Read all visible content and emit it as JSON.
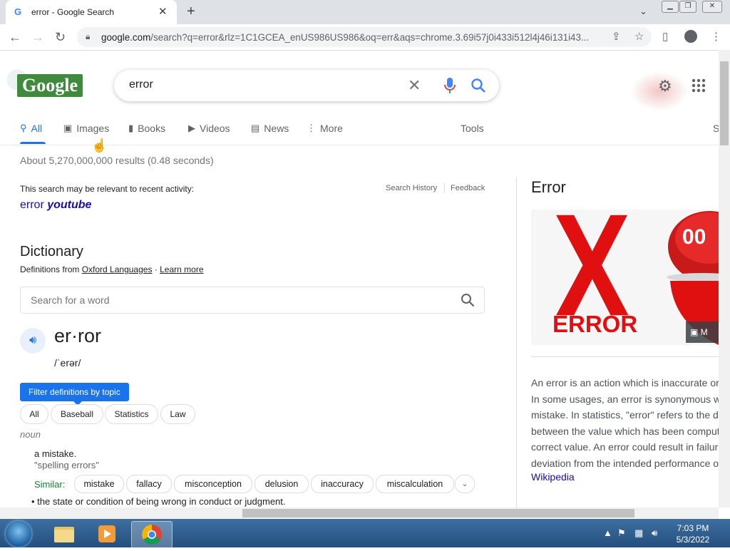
{
  "browser": {
    "tab_title": "error - Google Search",
    "tab_favicon": "G",
    "close_glyph": "✕",
    "new_tab_glyph": "+",
    "tab_search_glyph": "⌄",
    "url_host": "google.com",
    "url_rest": "/search?q=error&rlz=1C1GCEA_enUS986US986&oq=err&aqs=chrome.3.69i57j0i433i512l4j46i131i43..."
  },
  "google": {
    "logo_text": "Google",
    "query": "error",
    "nav_tabs": [
      {
        "label": "All",
        "icon": "search-icon"
      },
      {
        "label": "Images",
        "icon": "image-icon"
      },
      {
        "label": "Books",
        "icon": "book-icon"
      },
      {
        "label": "Videos",
        "icon": "video-icon"
      },
      {
        "label": "News",
        "icon": "news-icon"
      },
      {
        "label": "More",
        "icon": "more-vert-icon"
      }
    ],
    "tools_label": "Tools",
    "settings_partial": "S",
    "result_stats": "About 5,270,000,000 results (0.48 seconds)",
    "relevant_note": "This search may be relevant to recent activity:",
    "search_history": "Search History",
    "feedback": "Feedback",
    "related_link": {
      "plain": "error ",
      "bold": "youtube"
    }
  },
  "dictionary": {
    "title": "Dictionary",
    "defs_from_prefix": "Definitions from ",
    "source": "Oxford Languages",
    "separator": " · ",
    "learn_more": "Learn more",
    "search_placeholder": "Search for a word",
    "headword": "er·ror",
    "pronunciation": "/ˈerər/",
    "filter_tip": "Filter definitions by topic",
    "topic_chips": [
      "All",
      "Baseball",
      "Statistics",
      "Law"
    ],
    "part_of_speech": "noun",
    "definition_1": "a mistake.",
    "example_1": "\"spelling errors\"",
    "similar_label": "Similar:",
    "synonyms": [
      "mistake",
      "fallacy",
      "misconception",
      "delusion",
      "inaccuracy",
      "miscalculation"
    ],
    "definition_2": "the state or condition of being wrong in conduct or judgment."
  },
  "knowledge_panel": {
    "title": "Error",
    "image_x": "X",
    "image_caption": "ERROR",
    "image_badge": "00",
    "more_images": "M",
    "description_lines": [
      "An error is an action which is inaccurate or",
      "In some usages, an error is synonymous w",
      "mistake. In statistics, \"error\" refers to the d",
      "between the value which has been comput",
      "correct value. An error could result in failur",
      "deviation from the intended performance o"
    ],
    "source_link": "Wikipedia"
  },
  "taskbar": {
    "time": "7:03 PM",
    "date": "5/3/2022"
  },
  "colors": {
    "accent_blue": "#1a73e8",
    "link": "#1a0dab",
    "error_red": "#e01010"
  }
}
